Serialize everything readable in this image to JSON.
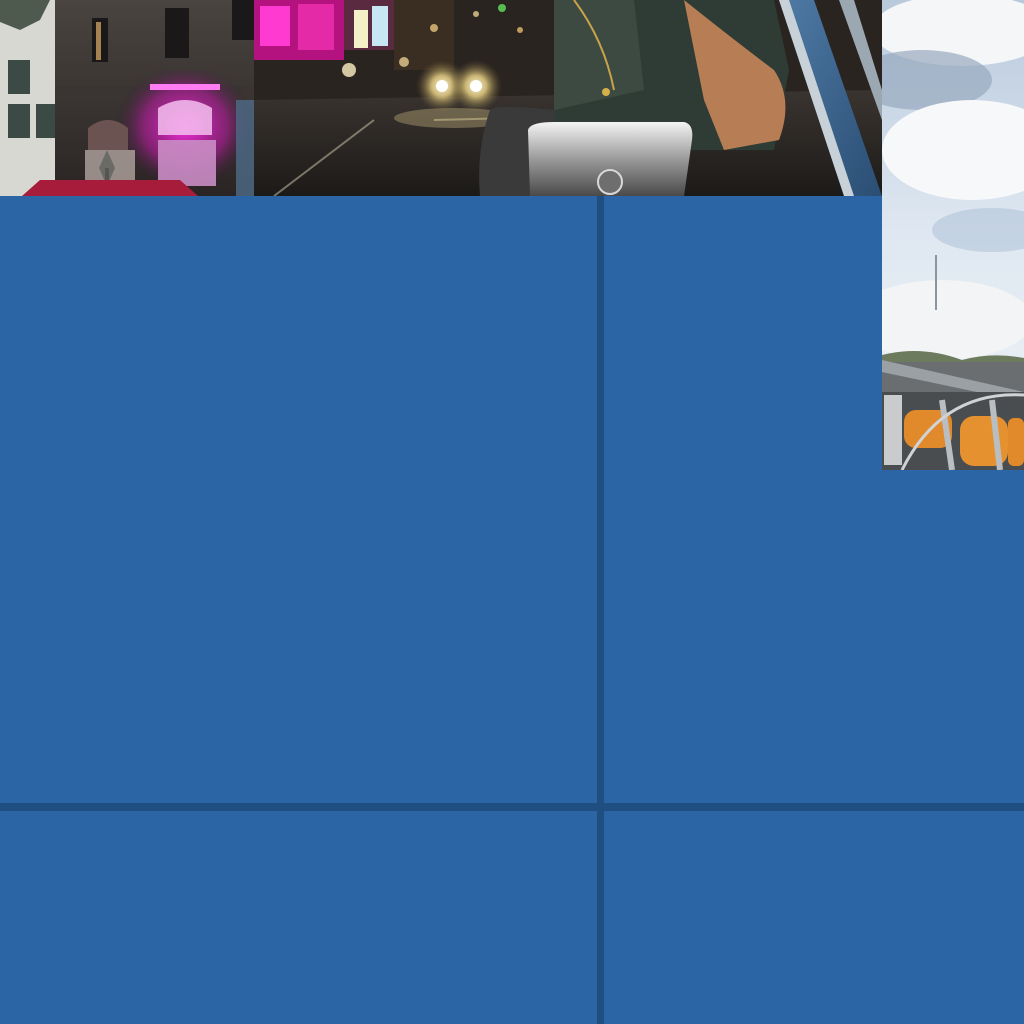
{
  "grid": {
    "background_color": "#2c65a5",
    "divider_color": "#1f4e80"
  },
  "tiles": [
    {
      "id": "building",
      "subject": "building-with-magenta-neon-light"
    },
    {
      "id": "street",
      "subject": "night-street-with-headlights-and-person-in-convertible"
    },
    {
      "id": "sky",
      "subject": "cloudy-sky-over-boat-with-orange-rope-coils"
    }
  ],
  "panels": [
    {
      "id": "top-left"
    },
    {
      "id": "top-right"
    },
    {
      "id": "right-strip"
    },
    {
      "id": "bottom-left"
    },
    {
      "id": "bottom-right"
    }
  ]
}
